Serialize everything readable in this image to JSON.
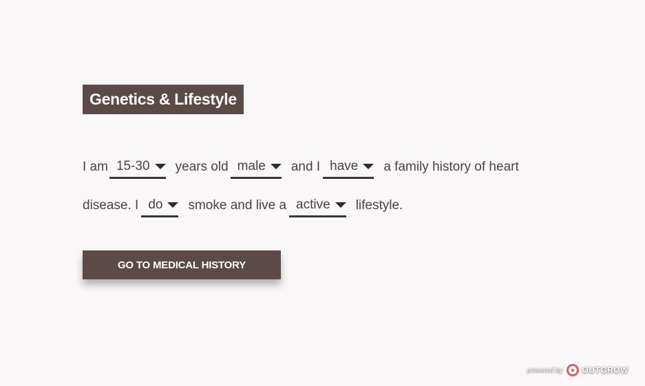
{
  "section": {
    "title": "Genetics & Lifestyle"
  },
  "sentence": {
    "t1": "I am",
    "age": "15-30",
    "t2": "years old",
    "gender": "male",
    "t3": "and I",
    "history": "have",
    "t4": "a family history of heart",
    "t5": "disease. I",
    "smoke": "do",
    "t6": "smoke and live a",
    "lifestyle": "active",
    "t7": "lifestyle."
  },
  "cta": {
    "label": "GO TO MEDICAL HISTORY"
  },
  "footer": {
    "powered_by": "powered by",
    "brand": "OUTGROW"
  },
  "colors": {
    "background": "#f9f7f8",
    "accent": "#5b4a47",
    "text": "#4a4143",
    "logo": "#e05a60"
  }
}
